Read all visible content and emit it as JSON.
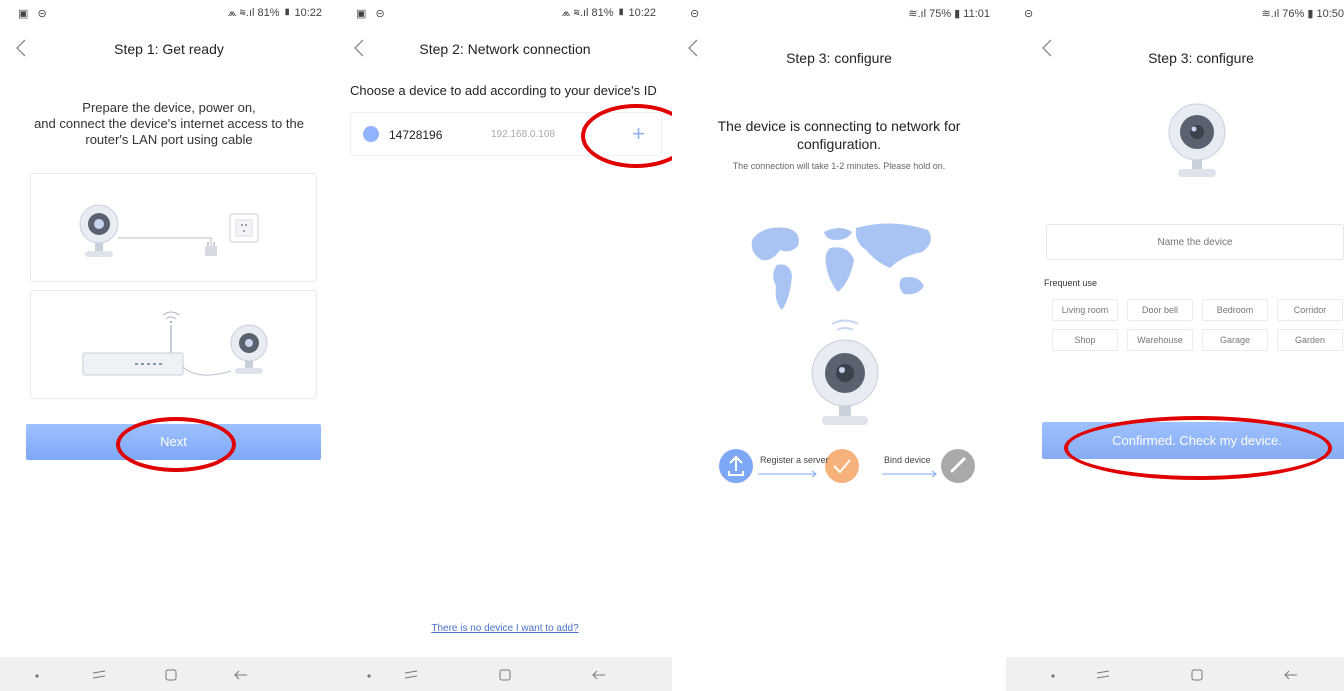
{
  "screen1": {
    "status_left": "▣ ⊝",
    "status_right": "⩕ ≋.ıl 81% ▮ 10:22",
    "title": "Step 1: Get ready",
    "instruction_line1": "Prepare the device, power on,",
    "instruction_line2": "and connect the device's internet access to the",
    "instruction_line3": "router's LAN port using cable",
    "next_button": "Next"
  },
  "screen2": {
    "status_left": "▣ ⊝",
    "status_right": "⩕ ≋.ıl 81% ▮ 10:22",
    "title": "Step 2: Network connection",
    "choose_text": "Choose a device to add according to your device's ID",
    "device": {
      "id": "14728196",
      "ip": "192.168.0.108",
      "add_symbol": "+"
    },
    "no_device_link": "There is no device I want to add?"
  },
  "screen3": {
    "status_left": "⊝",
    "status_right": "≋.ıl 75% ▮ 11:01",
    "title": "Step 3: configure",
    "connecting_line1": "The device is connecting to network for",
    "connecting_line2": "configuration.",
    "hold_on": "The connection will take 1-2 minutes. Please hold on.",
    "step_register": "Register a server",
    "step_bind": "Bind device"
  },
  "screen4": {
    "status_left": "⊝",
    "status_right": "≋.ıl 76% ▮ 10:50",
    "title": "Step 3: configure",
    "name_placeholder": "Name the device",
    "frequent_use_label": "Frequent use",
    "chips": [
      "Living room",
      "Door bell",
      "Bedroom",
      "Corridor",
      "Shop",
      "Warehouse",
      "Garage",
      "Garden"
    ],
    "confirm_button": "Confirmed. Check my device."
  },
  "colors": {
    "accent_blue": "#7ea8f5",
    "highlight_red": "#e00000",
    "step_orange": "#f6b27a",
    "step_gray": "#aaaaaa"
  },
  "icons": [
    "back-icon",
    "camera-icon",
    "plug-icon",
    "socket-icon",
    "router-icon",
    "wifi-icon",
    "world-map-icon",
    "upload-icon",
    "check-icon",
    "link-icon",
    "dot-icon",
    "recents-icon",
    "home-square-icon",
    "back-arrow-icon"
  ]
}
